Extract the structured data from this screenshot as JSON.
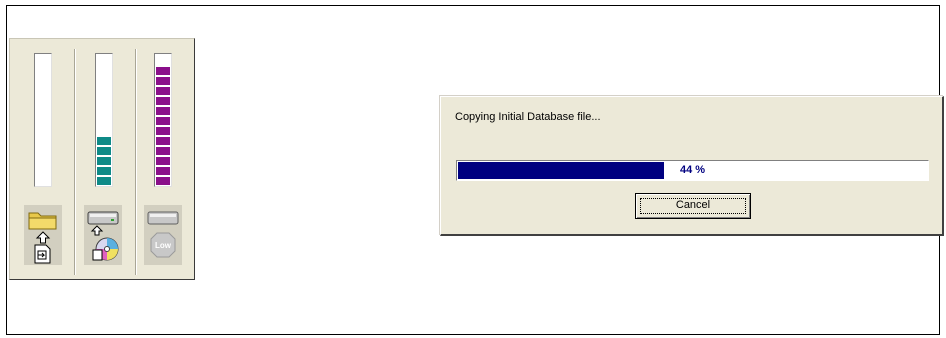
{
  "meters": [
    {
      "name": "file-transfer-meter",
      "level": 0,
      "color": ""
    },
    {
      "name": "disk-write-meter",
      "level": 0.36,
      "color": "#0e8a87"
    },
    {
      "name": "low-space-meter",
      "level": 0.92,
      "color": "#8a0f8a"
    }
  ],
  "icons": {
    "slot1": [
      "folder-icon",
      "up-arrow-icon",
      "document-icon"
    ],
    "slot2": [
      "drive-icon",
      "up-arrow-icon",
      "cd-icon"
    ],
    "slot3": [
      "drive-icon",
      "low-stop-icon"
    ]
  },
  "low_label": "Low",
  "dialog": {
    "message": "Copying Initial Database file...",
    "progress_percent": 44,
    "progress_text": "44 %",
    "progress_color": "#000080",
    "cancel_label": "Cancel"
  }
}
